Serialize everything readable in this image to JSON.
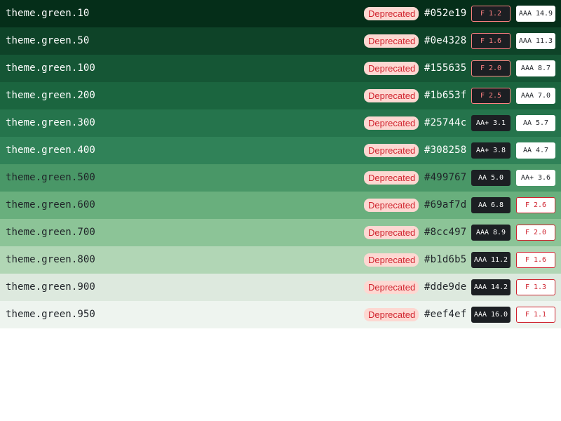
{
  "rows": [
    {
      "token": "theme.green.10",
      "status": "Deprecated",
      "hex": "#052e19",
      "color": "#052e19",
      "text_color": "#ffffff",
      "white_text": true,
      "on_dark": {
        "rating": "F 1.2",
        "fail": true
      },
      "on_light": {
        "rating": "AAA 14.9",
        "fail": false
      }
    },
    {
      "token": "theme.green.50",
      "status": "Deprecated",
      "hex": "#0e4328",
      "color": "#0e4328",
      "text_color": "#ffffff",
      "white_text": true,
      "on_dark": {
        "rating": "F 1.6",
        "fail": true
      },
      "on_light": {
        "rating": "AAA 11.3",
        "fail": false
      }
    },
    {
      "token": "theme.green.100",
      "status": "Deprecated",
      "hex": "#155635",
      "color": "#155635",
      "text_color": "#ffffff",
      "white_text": true,
      "on_dark": {
        "rating": "F 2.0",
        "fail": true
      },
      "on_light": {
        "rating": "AAA 8.7",
        "fail": false
      }
    },
    {
      "token": "theme.green.200",
      "status": "Deprecated",
      "hex": "#1b653f",
      "color": "#1b653f",
      "text_color": "#ffffff",
      "white_text": true,
      "on_dark": {
        "rating": "F 2.5",
        "fail": true
      },
      "on_light": {
        "rating": "AAA 7.0",
        "fail": false
      }
    },
    {
      "token": "theme.green.300",
      "status": "Deprecated",
      "hex": "#25744c",
      "color": "#25744c",
      "text_color": "#ffffff",
      "white_text": true,
      "on_dark": {
        "rating": "AA+ 3.1",
        "fail": false
      },
      "on_light": {
        "rating": "AA 5.7",
        "fail": false
      }
    },
    {
      "token": "theme.green.400",
      "status": "Deprecated",
      "hex": "#308258",
      "color": "#308258",
      "text_color": "#ffffff",
      "white_text": true,
      "on_dark": {
        "rating": "AA+ 3.8",
        "fail": false
      },
      "on_light": {
        "rating": "AA 4.7",
        "fail": false
      }
    },
    {
      "token": "theme.green.500",
      "status": "Deprecated",
      "hex": "#499767",
      "color": "#499767",
      "text_color": "#1f2328",
      "white_text": false,
      "on_dark": {
        "rating": "AA 5.0",
        "fail": false
      },
      "on_light": {
        "rating": "AA+ 3.6",
        "fail": false
      }
    },
    {
      "token": "theme.green.600",
      "status": "Deprecated",
      "hex": "#69af7d",
      "color": "#69af7d",
      "text_color": "#1f2328",
      "white_text": false,
      "on_dark": {
        "rating": "AA 6.8",
        "fail": false
      },
      "on_light": {
        "rating": "F 2.6",
        "fail": true
      }
    },
    {
      "token": "theme.green.700",
      "status": "Deprecated",
      "hex": "#8cc497",
      "color": "#8cc497",
      "text_color": "#1f2328",
      "white_text": false,
      "on_dark": {
        "rating": "AAA 8.9",
        "fail": false
      },
      "on_light": {
        "rating": "F 2.0",
        "fail": true
      }
    },
    {
      "token": "theme.green.800",
      "status": "Deprecated",
      "hex": "#b1d6b5",
      "color": "#b1d6b5",
      "text_color": "#1f2328",
      "white_text": false,
      "on_dark": {
        "rating": "AAA 11.2",
        "fail": false
      },
      "on_light": {
        "rating": "F 1.6",
        "fail": true
      }
    },
    {
      "token": "theme.green.900",
      "status": "Deprecated",
      "hex": "#dde9de",
      "color": "#dde9de",
      "text_color": "#1f2328",
      "white_text": false,
      "on_dark": {
        "rating": "AAA 14.2",
        "fail": false
      },
      "on_light": {
        "rating": "F 1.3",
        "fail": true
      }
    },
    {
      "token": "theme.green.950",
      "status": "Deprecated",
      "hex": "#eef4ef",
      "color": "#eef4ef",
      "text_color": "#1f2328",
      "white_text": false,
      "on_dark": {
        "rating": "AAA 16.0",
        "fail": false
      },
      "on_light": {
        "rating": "F 1.1",
        "fail": true
      }
    }
  ]
}
